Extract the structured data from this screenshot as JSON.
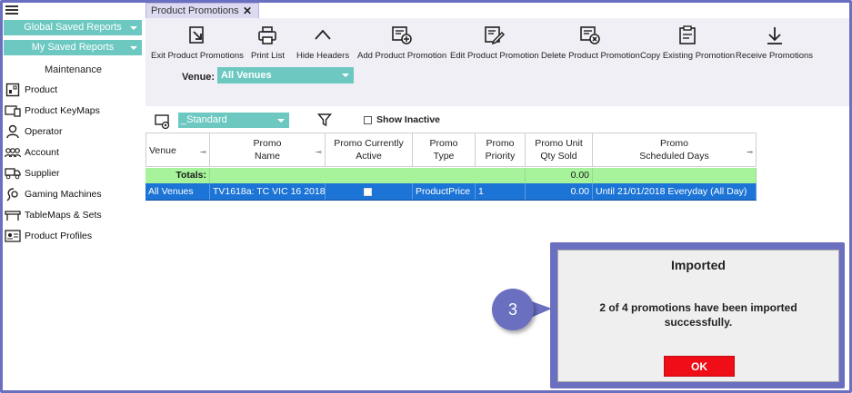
{
  "sidebar": {
    "global_saved_reports": "Global Saved Reports",
    "my_saved_reports": "My Saved Reports",
    "section_title": "Maintenance",
    "items": [
      {
        "label": "Product",
        "icon": "product-icon"
      },
      {
        "label": "Product KeyMaps",
        "icon": "keymap-icon"
      },
      {
        "label": "Operator",
        "icon": "operator-icon"
      },
      {
        "label": "Account",
        "icon": "account-icon"
      },
      {
        "label": "Supplier",
        "icon": "supplier-icon"
      },
      {
        "label": "Gaming Machines",
        "icon": "gaming-machine-icon"
      },
      {
        "label": "TableMaps & Sets",
        "icon": "tablemap-icon"
      },
      {
        "label": "Product Profiles",
        "icon": "profile-icon"
      }
    ]
  },
  "tab": {
    "label": "Product Promotions",
    "close": "✕"
  },
  "toolbar": {
    "exit": "Exit Product Promotions",
    "print": "Print List",
    "hide_headers": "Hide Headers",
    "add": "Add Product Promotion",
    "edit": "Edit Product Promotion",
    "delete": "Delete Product Promotion",
    "copy": "Copy Existing Promotion",
    "receive": "Receive Promotions"
  },
  "venue": {
    "label": "Venue:",
    "value": "All Venues"
  },
  "layout": {
    "value": "_Standard"
  },
  "show_inactive": {
    "label": "Show Inactive",
    "checked": false
  },
  "grid": {
    "headers": {
      "venue": "Venue",
      "promo_name_1": "Promo",
      "promo_name_2": "Name",
      "active_1": "Promo Currently",
      "active_2": "Active",
      "type_1": "Promo",
      "type_2": "Type",
      "priority_1": "Promo",
      "priority_2": "Priority",
      "qty_1": "Promo Unit",
      "qty_2": "Qty Sold",
      "days_1": "Promo",
      "days_2": "Scheduled Days"
    },
    "totals": {
      "label": "Totals:",
      "qty": "0.00"
    },
    "rows": [
      {
        "venue": "All Venues",
        "name": "TV1618a: TC VIC 16 2018",
        "active": "",
        "type": "ProductPrice",
        "priority": "1",
        "qty": "0.00",
        "days": "Until 21/01/2018 Everyday (All Day)"
      }
    ]
  },
  "dialog": {
    "title": "Imported",
    "message": "2 of 4 promotions have been imported successfully.",
    "ok": "OK"
  },
  "callout": {
    "number": "3"
  },
  "colors": {
    "frame": "#6a6fc0",
    "teal": "#6cc8c1",
    "totals": "#a6f39b",
    "selected_row": "#1c74d6",
    "ok_button": "#ef0d17"
  }
}
